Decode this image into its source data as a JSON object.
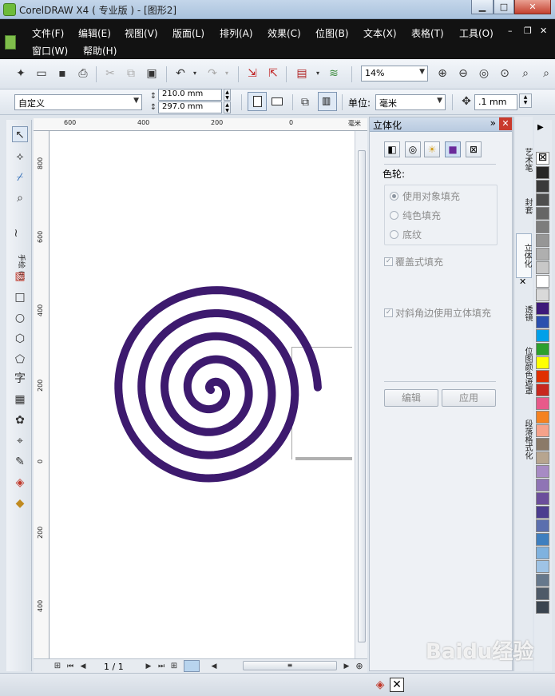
{
  "window": {
    "title": "CorelDRAW X4 ( 专业版 ) - [图形2]"
  },
  "menu": [
    "文件(F)",
    "编辑(E)",
    "视图(V)",
    "版面(L)",
    "排列(A)",
    "效果(C)",
    "位图(B)",
    "文本(X)",
    "表格(T)",
    "工具(O)",
    "窗口(W)",
    "帮助(H)"
  ],
  "toolbar": {
    "zoom": "14%"
  },
  "propbar": {
    "paper_type": "自定义",
    "width": "210.0 mm",
    "height": "297.0 mm",
    "units_label": "单位:",
    "units": "毫米",
    "nudge": ".1 mm"
  },
  "toolbox": {
    "freehand_label": "手绘 (F)",
    "text_tool_glyph": "字"
  },
  "ruler": {
    "h_labels": [
      "600",
      "400",
      "200",
      "0"
    ],
    "h_unit": "毫米",
    "v_labels": [
      "800",
      "600",
      "400",
      "200",
      "0",
      "200",
      "400"
    ],
    "v_unit": "毫米"
  },
  "page_nav": {
    "counter": "1 / 1"
  },
  "docker": {
    "title": "立体化",
    "color_wheel_label": "色轮:",
    "options": [
      "使用对象填充",
      "纯色填充",
      "底纹"
    ],
    "selected_option": "使用对象填充",
    "overprint_label": "覆盖式填充",
    "bevel_label": "对斜角边使用立体填充",
    "edit_button": "编辑",
    "apply_button": "应用"
  },
  "side_tabs": [
    "艺术笔",
    "封套",
    "立体化",
    "透镜",
    "位图颜色遮罩",
    "段落格式化"
  ],
  "palette": [
    "#262626",
    "#3a3a3a",
    "#4e4e4e",
    "#666666",
    "#7d7d7d",
    "#969696",
    "#afafaf",
    "#c8c8c8",
    "#ffffff",
    "#d9d9d9",
    "#3d1a7a",
    "#2a4fae",
    "#00a0e9",
    "#2ca02c",
    "#ffff00",
    "#e03000",
    "#c8281e",
    "#e85a8a",
    "#f58220",
    "#f6a28a",
    "#8b7a68",
    "#b7a58f",
    "#a78bc4",
    "#8f74b5",
    "#6b4e9b",
    "#4b3d8f",
    "#5b6fae",
    "#3f7fbf",
    "#7fb2df",
    "#9ec3e5",
    "#66788c",
    "#4e5a68",
    "#3a444f"
  ],
  "spiral_color": "#3d1a6e",
  "watermark": "Baidu经验"
}
